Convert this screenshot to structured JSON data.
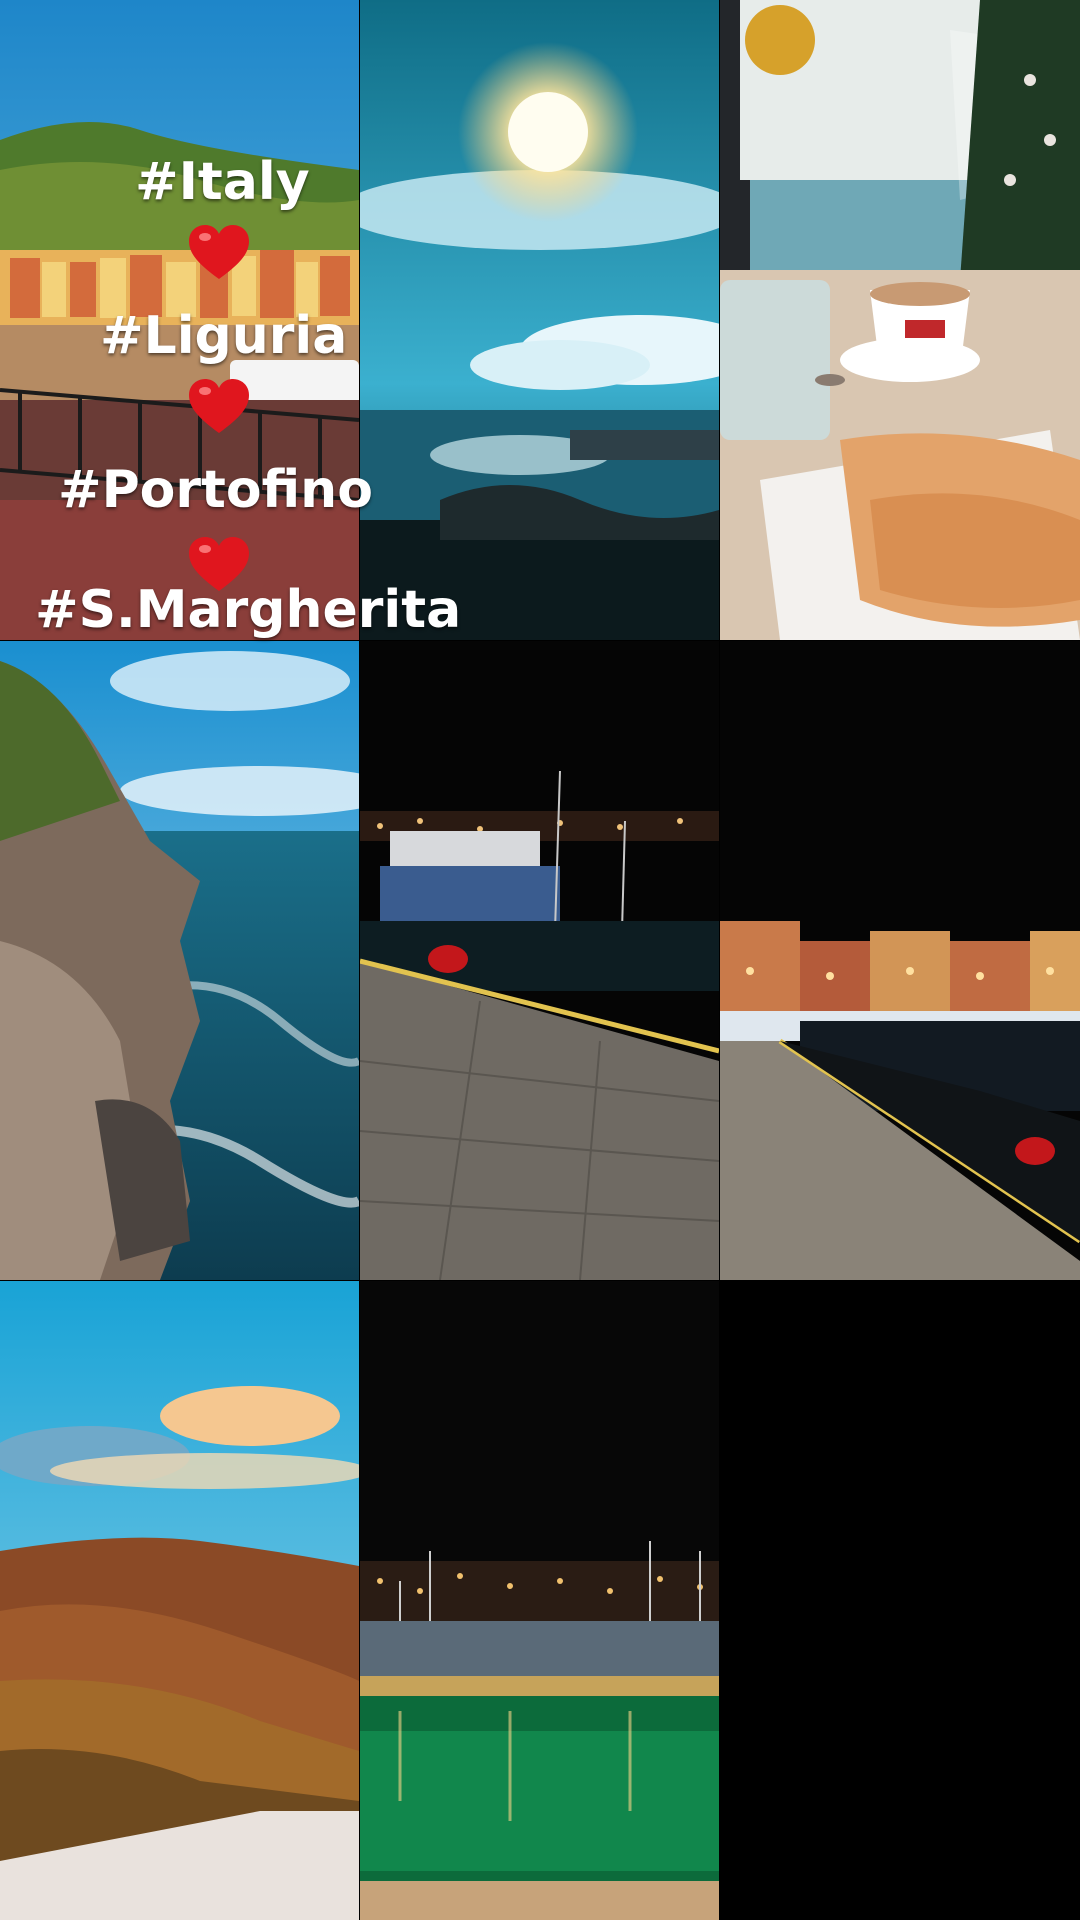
{
  "overlay": {
    "hashtags": [
      "#Italy",
      "#Liguria",
      "#Portofino",
      "#S.Margherita"
    ],
    "heart_icon": "red-heart-emoji",
    "heart_color": "#e0161e"
  },
  "tiles": [
    {
      "scene": "portofino-harbor-houses"
    },
    {
      "scene": "sun-over-sea"
    },
    {
      "scene": "cafe-espresso-focaccia"
    },
    {
      "scene": "rocky-coast-waves"
    },
    {
      "scene": "harbor-pier-night"
    },
    {
      "scene": "waterfront-promenade-night"
    },
    {
      "scene": "autumn-hills-sky"
    },
    {
      "scene": "marina-boats-night"
    },
    {
      "scene": "black-empty"
    }
  ],
  "colors": {
    "background": "#000000",
    "text": "#ffffff"
  }
}
